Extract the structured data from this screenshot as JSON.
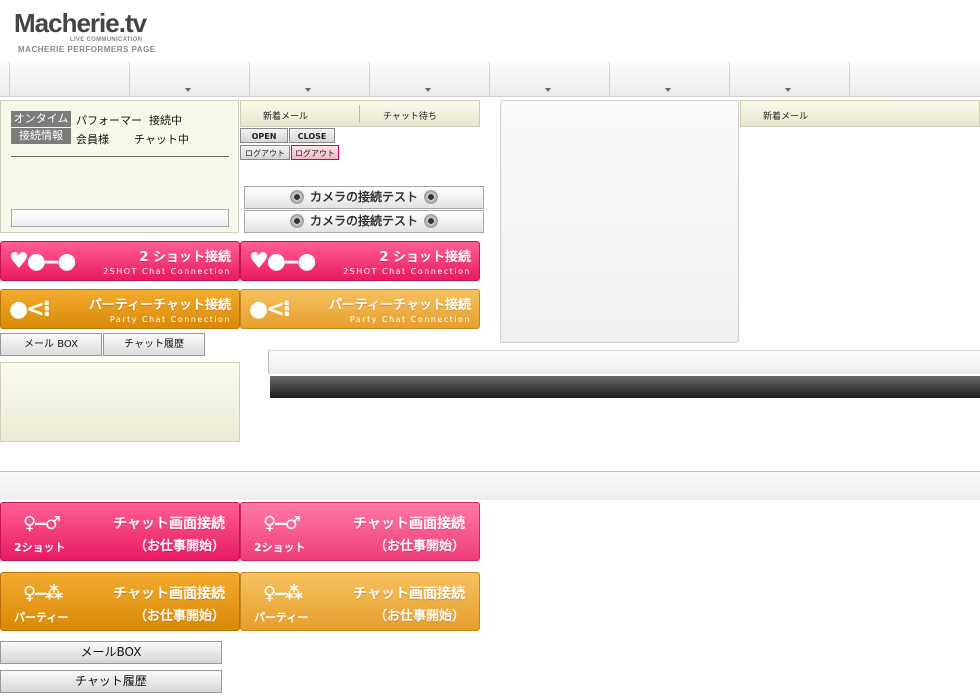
{
  "header": {
    "logo_text": "Macherie.tv",
    "logo_tagline": "LIVE COMMUNICATION",
    "subtitle": "MACHERIE PERFORMERS PAGE"
  },
  "nav": {
    "tab_count": 8
  },
  "status": {
    "badge_online": "オンタイム",
    "badge_info": "接続情報",
    "performer_label": "パフォーマー",
    "performer_state": "接続中",
    "member_label": "会員様",
    "member_state": "チャット中"
  },
  "tabs_left": {
    "mail": "新着メール",
    "waiting": "チャット待ち"
  },
  "tabs_right": {
    "mail": "新着メール"
  },
  "mini": {
    "open": "OPEN",
    "close": "CLOSE",
    "logout1": "ログアウト",
    "logout2": "ログアウト"
  },
  "camera_test": {
    "label": "カメラの接続テスト"
  },
  "banners": {
    "two_shot_title": "2 ショット接続",
    "two_shot_sub": "2SHOT Chat Connection",
    "party_title": "パーティーチャット接続",
    "party_sub": "Party Chat Connection"
  },
  "buttons_small": {
    "mailbox": "メール BOX",
    "history": "チャット履歴"
  },
  "work": {
    "title": "チャット画面接続",
    "subtitle": "（お仕事開始）",
    "two_shot_label": "2ショット",
    "party_label": "パーティー"
  },
  "buttons_wide": {
    "mailbox": "メールBOX",
    "history": "チャット履歴"
  },
  "colors": {
    "pink": "#e81a63",
    "orange": "#d98a07"
  }
}
